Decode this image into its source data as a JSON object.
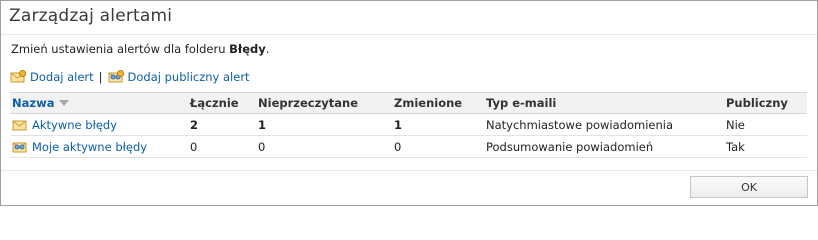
{
  "dialog": {
    "title": "Zarządzaj alertami",
    "description_prefix": "Zmień ustawienia alertów dla folderu",
    "folder_name": "Błędy",
    "description_suffix": "."
  },
  "actions": {
    "add_alert": "Dodaj alert",
    "separator": "|",
    "add_public_alert": "Dodaj publiczny alert"
  },
  "table": {
    "headers": {
      "name": "Nazwa",
      "total": "Łącznie",
      "unread": "Nieprzeczytane",
      "changed": "Zmienione",
      "email_type": "Typ e-maili",
      "public": "Publiczny"
    },
    "rows": [
      {
        "name": "Aktywne błędy",
        "total": "2",
        "unread": "1",
        "changed": "1",
        "email_type": "Natychmiastowe powiadomienia",
        "public": "Nie"
      },
      {
        "name": "Moje aktywne błędy",
        "total": "0",
        "unread": "0",
        "changed": "0",
        "email_type": "Podsumowanie powiadomień",
        "public": "Tak"
      }
    ]
  },
  "buttons": {
    "ok": "OK"
  }
}
